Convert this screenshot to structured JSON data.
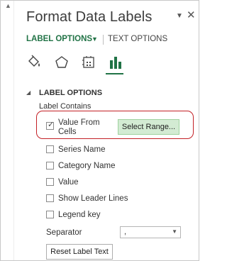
{
  "pane": {
    "title": "Format Data Labels"
  },
  "tabs": {
    "label_options": "LABEL OPTIONS",
    "text_options": "TEXT OPTIONS"
  },
  "icons": [
    "fill-line-icon",
    "effects-icon",
    "size-properties-icon",
    "label-options-icon"
  ],
  "section": {
    "header": "LABEL OPTIONS",
    "label_contains": "Label Contains"
  },
  "options": {
    "value_from_cells_line1": "Value From",
    "value_from_cells_line2": "Cells",
    "series_name": "Series Name",
    "category_name": "Category Name",
    "value": "Value",
    "show_leader_lines": "Show Leader Lines",
    "legend_key": "Legend key"
  },
  "checked": {
    "value_from_cells": true,
    "series_name": false,
    "category_name": false,
    "value": false,
    "show_leader_lines": false,
    "legend_key": false
  },
  "buttons": {
    "select_range": "Select Range...",
    "reset_label_text": "Reset Label Text"
  },
  "separator": {
    "label": "Separator",
    "value": ","
  },
  "colors": {
    "accent": "#217346",
    "highlight": "#c32026",
    "select_range_bg": "#d3ebd3"
  }
}
